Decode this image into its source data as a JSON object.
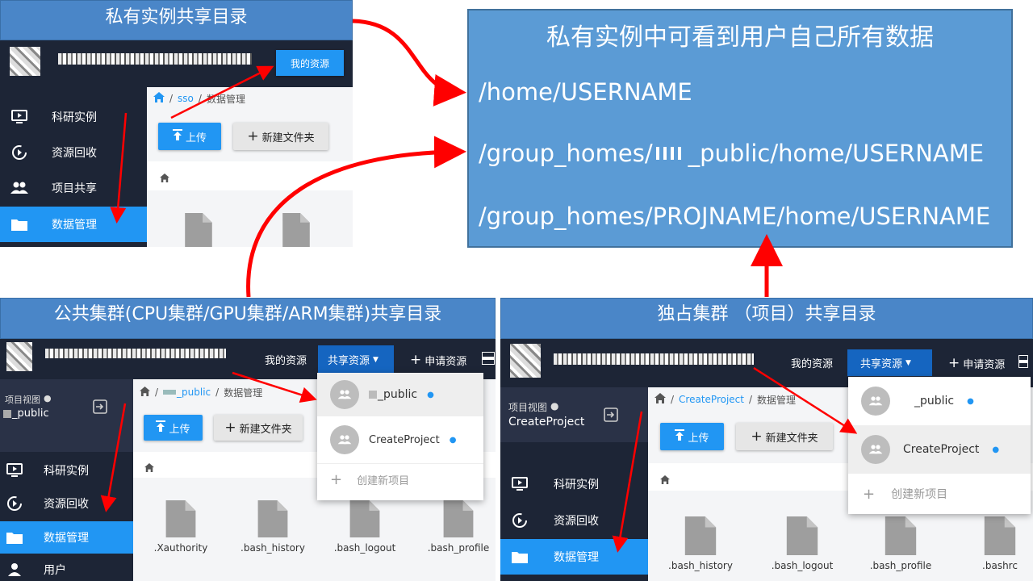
{
  "panel_top_left": {
    "caption": "私有实例共享目录",
    "my_resources": "我的资源",
    "breadcrumb": [
      "sso",
      "数据管理"
    ],
    "upload": "上传",
    "new_folder": "新建文件夹",
    "sidebar": [
      "科研实例",
      "资源回收",
      "项目共享",
      "数据管理"
    ]
  },
  "info_box": {
    "title": "私有实例中可看到用户自己所有数据",
    "paths": [
      "/home/USERNAME",
      "/group_homes/",
      "_public/home/USERNAME",
      "/group_homes/PROJNAME/home/USERNAME"
    ]
  },
  "panel_bottom_left": {
    "caption": "公共集群(CPU集群/GPU集群/ARM集群)共享目录",
    "nav": [
      "我的资源",
      "共享资源",
      "申请资源"
    ],
    "project_view_label": "项目视图",
    "project_name": "_public",
    "breadcrumb": [
      "_public",
      "数据管理"
    ],
    "upload": "上传",
    "new_folder": "新建文件夹",
    "sidebar": [
      "科研实例",
      "资源回收",
      "数据管理",
      "用户"
    ],
    "dropdown": [
      "_public",
      "CreateProject",
      "创建新项目"
    ],
    "files": [
      ".Xauthority",
      ".bash_history",
      ".bash_logout",
      ".bash_profile"
    ]
  },
  "panel_bottom_right": {
    "caption": "独占集群 （项目）共享目录",
    "nav": [
      "我的资源",
      "共享资源",
      "申请资源"
    ],
    "project_view_label": "项目视图",
    "project_name": "CreateProject",
    "breadcrumb": [
      "CreateProject",
      "数据管理"
    ],
    "upload": "上传",
    "new_folder": "新建文件夹",
    "sidebar": [
      "科研实例",
      "资源回收",
      "数据管理"
    ],
    "dropdown": [
      "_public",
      "CreateProject",
      "创建新项目"
    ],
    "files": [
      ".bash_history",
      ".bash_logout",
      ".bash_profile",
      ".bashrc"
    ]
  },
  "colors": {
    "caption_bg": "#4a86c8",
    "info_bg": "#5b9bd5",
    "topbar": "#1d2536",
    "accent": "#2196f3",
    "arrow": "#ff0000"
  }
}
